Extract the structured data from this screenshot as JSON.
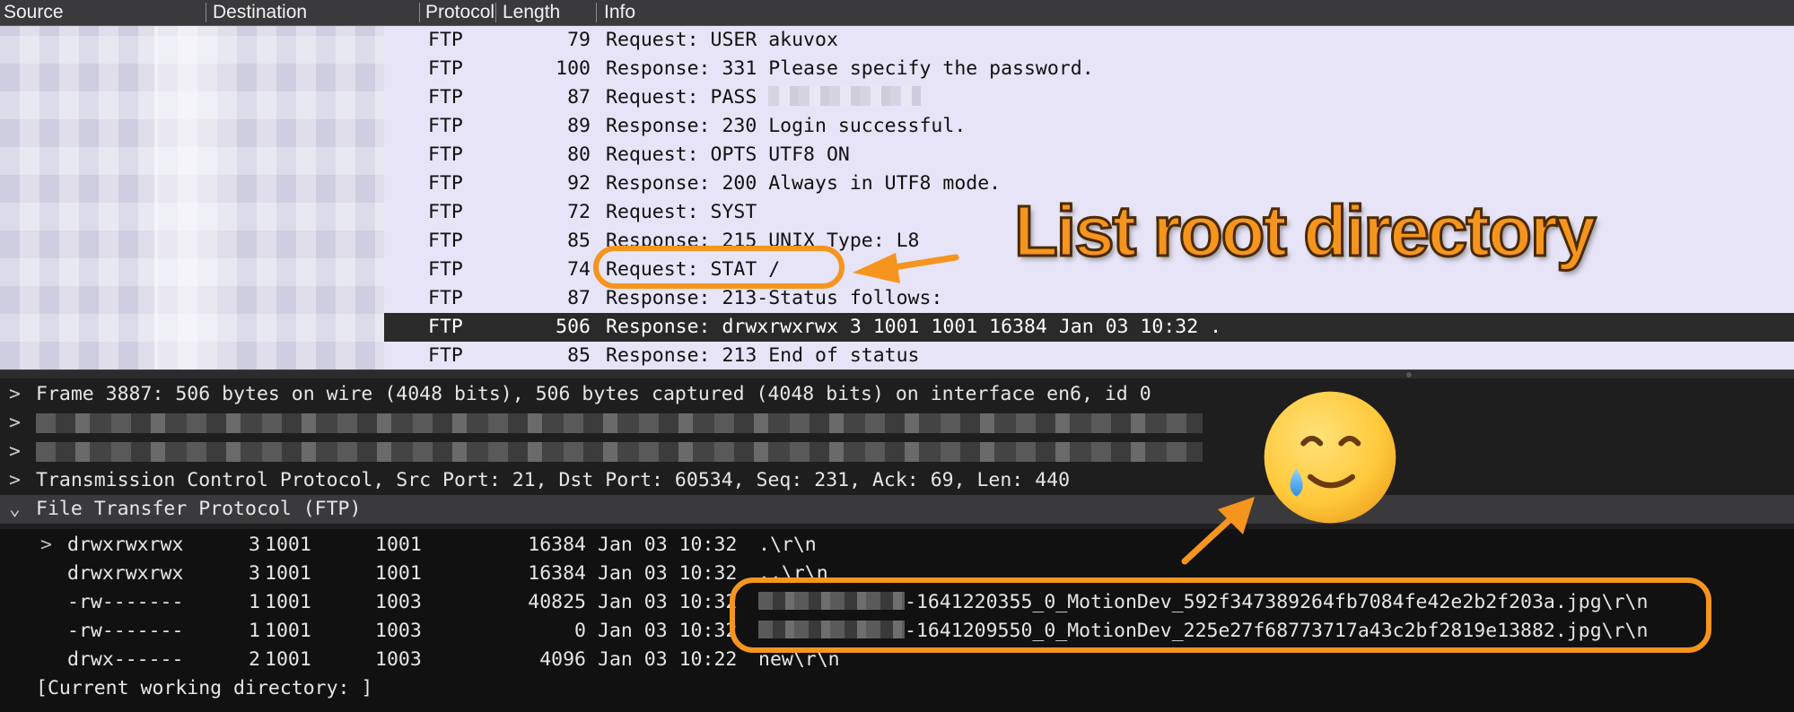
{
  "header": {
    "columns": [
      "Source",
      "Destination",
      "Protocol",
      "Length",
      "Info"
    ]
  },
  "packets": [
    {
      "protocol": "FTP",
      "length": "79",
      "info": "Request: USER akuvox"
    },
    {
      "protocol": "FTP",
      "length": "100",
      "info": "Response: 331 Please specify the password."
    },
    {
      "protocol": "FTP",
      "length": "87",
      "info": "Request: PASS "
    },
    {
      "protocol": "FTP",
      "length": "89",
      "info": "Response: 230 Login successful."
    },
    {
      "protocol": "FTP",
      "length": "80",
      "info": "Request: OPTS UTF8 ON"
    },
    {
      "protocol": "FTP",
      "length": "92",
      "info": "Response: 200 Always in UTF8 mode."
    },
    {
      "protocol": "FTP",
      "length": "72",
      "info": "Request: SYST"
    },
    {
      "protocol": "FTP",
      "length": "85",
      "info": "Response: 215 UNIX Type: L8"
    },
    {
      "protocol": "FTP",
      "length": "74",
      "info": "Request: STAT /"
    },
    {
      "protocol": "FTP",
      "length": "87",
      "info": "Response: 213-Status follows:"
    },
    {
      "protocol": "FTP",
      "length": "506",
      "info": "Response: drwxrwxrwx    3 1001     1001        16384 Jan 03 10:32 ."
    },
    {
      "protocol": "FTP",
      "length": "85",
      "info": "Response: 213 End of status"
    }
  ],
  "annotation": {
    "callout": "List root directory",
    "accent_color": "#f5951e"
  },
  "details": {
    "frame": "Frame 3887: 506 bytes on wire (4048 bits), 506 bytes captured (4048 bits) on interface en6, id 0",
    "tcp": "Transmission Control Protocol, Src Port: 21, Dst Port: 60534, Seq: 231, Ack: 69, Len: 440",
    "ftp": "File Transfer Protocol (FTP)"
  },
  "listing": [
    {
      "perm": "drwxrwxrwx",
      "links": "3",
      "uid": "1001",
      "gid": "1001",
      "size": "16384",
      "date": "Jan 03 10:32",
      "name": ".\\r\\n"
    },
    {
      "perm": "drwxrwxrwx",
      "links": "3",
      "uid": "1001",
      "gid": "1001",
      "size": "16384",
      "date": "Jan 03 10:32",
      "name": "..\\r\\n"
    },
    {
      "perm": "-rw-------",
      "links": "1",
      "uid": "1001",
      "gid": "1003",
      "size": "40825",
      "date": "Jan 03 10:32",
      "name": "-1641220355_0_MotionDev_592f347389264fb7084fe42e2b2f203a.jpg\\r\\n"
    },
    {
      "perm": "-rw-------",
      "links": "1",
      "uid": "1001",
      "gid": "1003",
      "size": "0",
      "date": "Jan 03 10:32",
      "name": "-1641209550_0_MotionDev_225e27f68773717a43c2bf2819e13882.jpg\\r\\n"
    },
    {
      "perm": "drwx------",
      "links": "2",
      "uid": "1001",
      "gid": "1003",
      "size": "4096",
      "date": "Jan 03 10:22",
      "name": "new\\r\\n"
    }
  ],
  "cwd": "[Current working directory: ]",
  "emoji": "smiling-face-with-tear"
}
